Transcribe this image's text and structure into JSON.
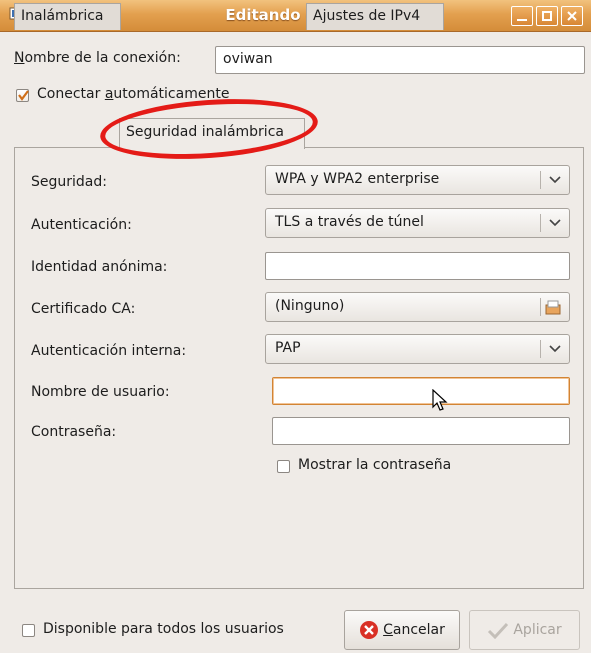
{
  "window": {
    "title": "Editando oviwan",
    "icons": [
      "app-icon",
      "minimize-icon",
      "maximize-icon",
      "close-icon"
    ]
  },
  "connection": {
    "name_label_prefix": "N",
    "name_label_rest": "ombre de la conexión:",
    "name_value": "oviwan",
    "auto_connect_prefix": "Conectar ",
    "auto_connect_underlined": "a",
    "auto_connect_suffix": "utomáticamente",
    "auto_connect_checked": true
  },
  "tabs": [
    {
      "label": "Inalámbrica",
      "active": false
    },
    {
      "label": "Seguridad inalámbrica",
      "active": true
    },
    {
      "label": "Ajustes de IPv4",
      "active": false
    }
  ],
  "security_form": {
    "seguridad_label": "Seguridad:",
    "seguridad_value": "WPA y WPA2 enterprise",
    "autenticacion_label": "Autenticación:",
    "autenticacion_value": "TLS a través de túnel",
    "identidad_label": "Identidad anónima:",
    "identidad_value": "",
    "certificado_label": "Certificado CA:",
    "certificado_value": "(Ninguno)",
    "auth_interna_label": "Autenticación interna:",
    "auth_interna_value": "PAP",
    "usuario_label": "Nombre de usuario:",
    "usuario_value": "",
    "contrasena_label": "Contraseña:",
    "contrasena_value": "",
    "mostrar_contrasena_label": "Mostrar la contraseña",
    "mostrar_contrasena_checked": false
  },
  "footer": {
    "disponible_label": "Disponible para todos los usuarios",
    "disponible_checked": false,
    "cancel_underlined": "C",
    "cancel_rest": "ancelar",
    "apply_label": "Aplicar",
    "apply_enabled": false
  },
  "colors": {
    "titlebar": "#e3a04f",
    "annotation": "#e41b17",
    "focus_border": "#d28434",
    "cancel_icon": "#d93025"
  }
}
